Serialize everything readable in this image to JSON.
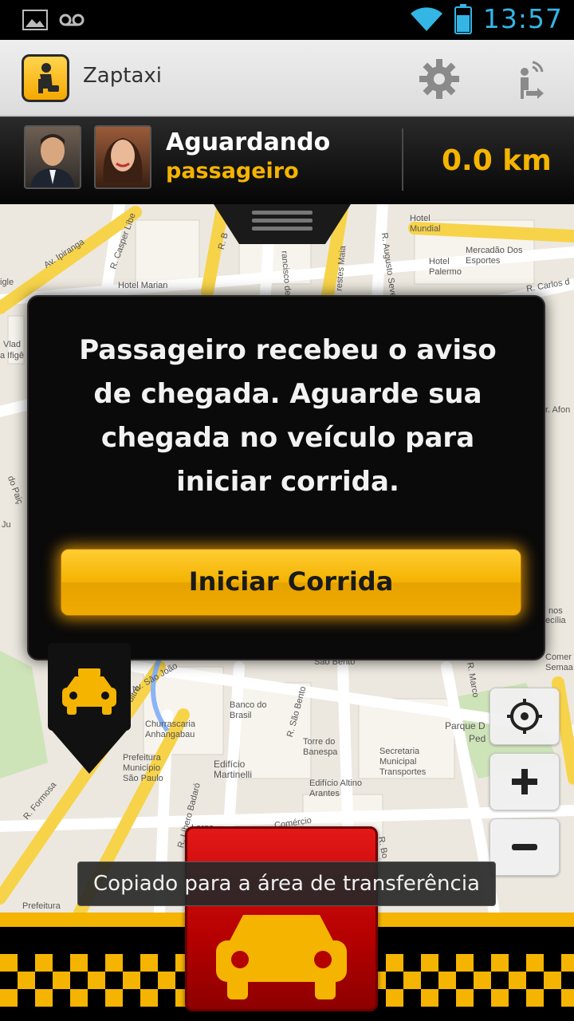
{
  "status_bar": {
    "time": "13:57",
    "icons": [
      "image-notification-icon",
      "voicemail-icon",
      "wifi-icon",
      "battery-icon"
    ],
    "time_color": "#33b5e5"
  },
  "action_bar": {
    "app_title": "Zaptaxi",
    "icons": [
      "zaptaxi-logo-icon",
      "gear-icon",
      "passenger-signal-icon"
    ]
  },
  "info_bar": {
    "status_line1": "Aguardando",
    "status_line2": "passageiro",
    "distance": "0.0 km",
    "accent_color": "#f4b400"
  },
  "map": {
    "labels": {
      "av_ipiranga": "Av. Ipiranga",
      "casper_libero": "R. Casper Líbe",
      "hotel_marian": "Hotel Marian",
      "r_b": "R. B",
      "francisco": "rancisco de",
      "prestes_maia": "restes Maia",
      "augusto_severo": "R. Augusto Seve",
      "hotel_mundial": "Hotel Mundial",
      "hotel_palermo": "Hotel Palermo",
      "mercadao": "Mercadão Dos Esportes",
      "r_carlos": "R. Carlos d",
      "r_afon": "r. Afon",
      "vlad": "Vlad",
      "ifige": "a Ifigê",
      "igle": "igle",
      "do_paic": "do Paiç",
      "ju": "Ju",
      "av_sao_joao": "Av. São João",
      "ultro": "ultro",
      "sao_bento_top": "São Bento",
      "r_sao_bento": "R. São Bento",
      "banco_brasil": "Banco do Brasil",
      "churrascaria": "Churrascaria Anhangabau",
      "prefeitura": "Prefeitura Município São Paulo",
      "r_libero_badaro": "R. Líbero Badaró",
      "edificio_martinelli": "Edifício Martinelli",
      "torre_banespa": "Torre do Banespa",
      "edificio_altino": "Edifício Altino Arantes",
      "secretaria": "Secretaria Municipal Transportes",
      "parque": "Parque D",
      "ped": "Ped",
      "marco": "R. Marco",
      "nos": "nos",
      "ecilia": "ecília",
      "comer": "Comer Semaa",
      "r_formosa": "R. Formosa",
      "largo": "Largo",
      "comercio": "Comércio",
      "prefeitura_bottom": "Prefeitura",
      "r_bo": "R. Bo"
    }
  },
  "dialog": {
    "message": "Passageiro recebeu o aviso de chegada. Aguarde sua chegada no veículo para iniciar corrida.",
    "button_label": "Iniciar Corrida",
    "button_color": "#f4b400"
  },
  "map_controls": {
    "icons": [
      "locate-icon",
      "zoom-in-icon",
      "zoom-out-icon"
    ]
  },
  "toast": {
    "text": "Copiado para a área de transferência"
  },
  "bottom_bar": {
    "icons": [
      "taxi-car-icon"
    ],
    "button_color": "#d10d0d"
  }
}
